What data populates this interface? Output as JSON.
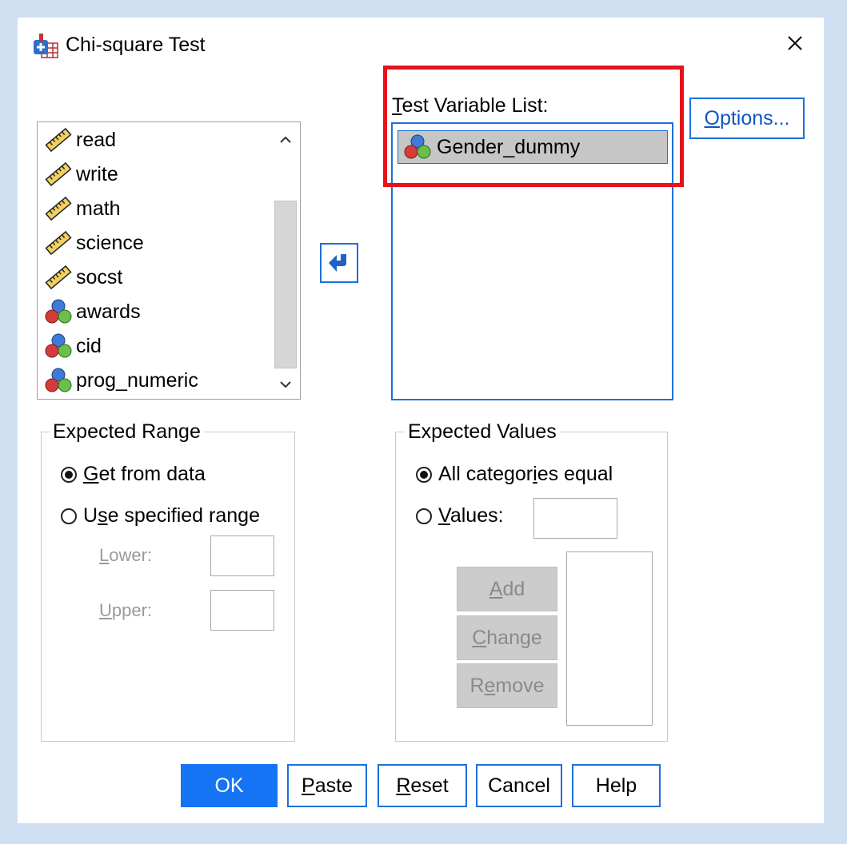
{
  "window": {
    "title": "Chi-square Test"
  },
  "source_list": {
    "items": [
      {
        "label": "read",
        "icon": "ruler-icon"
      },
      {
        "label": "write",
        "icon": "ruler-icon"
      },
      {
        "label": "math",
        "icon": "ruler-icon"
      },
      {
        "label": "science",
        "icon": "ruler-icon"
      },
      {
        "label": "socst",
        "icon": "ruler-icon"
      },
      {
        "label": "awards",
        "icon": "nominal-balls-icon"
      },
      {
        "label": "cid",
        "icon": "nominal-balls-icon"
      },
      {
        "label": "prog_numeric",
        "icon": "nominal-balls-icon"
      }
    ]
  },
  "test_variables": {
    "label_u": "T",
    "label_rest": "est Variable List:",
    "items": [
      {
        "label": "Gender_dummy",
        "icon": "nominal-balls-icon"
      }
    ]
  },
  "options_button": {
    "u": "O",
    "rest": "ptions..."
  },
  "expected_range": {
    "title": "Expected Range",
    "get_from_data": {
      "u": "G",
      "rest": "et from data"
    },
    "use_range": {
      "pre": "U",
      "u": "s",
      "rest": "e specified range"
    },
    "lower": {
      "u": "L",
      "rest": "ower:"
    },
    "upper": {
      "u": "U",
      "rest": "pper:"
    }
  },
  "expected_values": {
    "title": "Expected Values",
    "all_equal": {
      "pre": "All categor",
      "u": "i",
      "rest": "es equal"
    },
    "values": {
      "u": "V",
      "rest": "alues:"
    },
    "add": {
      "u": "A",
      "rest": "dd"
    },
    "change": {
      "u": "C",
      "rest": "hange"
    },
    "remove": {
      "pre": "R",
      "u": "e",
      "rest": "move"
    }
  },
  "buttons": {
    "ok": "OK",
    "paste": {
      "u": "P",
      "rest": "aste"
    },
    "reset": {
      "u": "R",
      "rest": "eset"
    },
    "cancel": "Cancel",
    "help": "Help"
  },
  "colors": {
    "accent": "#1e6fd9",
    "highlight": "#e8121a",
    "ok_bg": "#1574f3"
  }
}
